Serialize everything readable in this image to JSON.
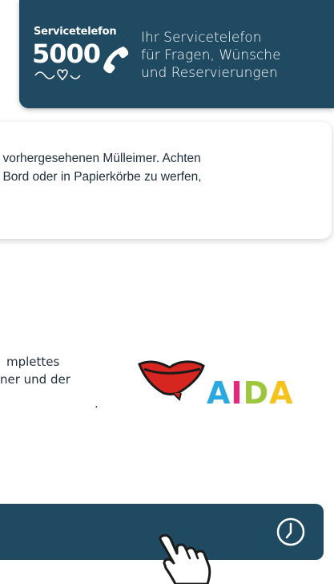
{
  "service": {
    "label": "Servicetelefon",
    "number": "5000",
    "lines": [
      "Ihr Servicetelefon",
      "für Fragen, Wünsche",
      "und Reservierungen"
    ]
  },
  "notice": {
    "line1": "r vorhergesehenen Mülleimer. Achten",
    "line2": "r Bord oder in Papierkörbe zu werfen,"
  },
  "info": {
    "lines": [
      "mplettes",
      "ner und der",
      "."
    ]
  },
  "logo": {
    "letters": [
      "A",
      "I",
      "D",
      "A"
    ],
    "letter_colors": [
      "#2aa8e0",
      "#e5287e",
      "#9cc63b",
      "#f6c21c"
    ]
  },
  "colors": {
    "primary": "#1f4a61",
    "lips": "#d7261f"
  },
  "icons": [
    "phone-icon",
    "clock-icon",
    "pointer-hand-icon"
  ]
}
